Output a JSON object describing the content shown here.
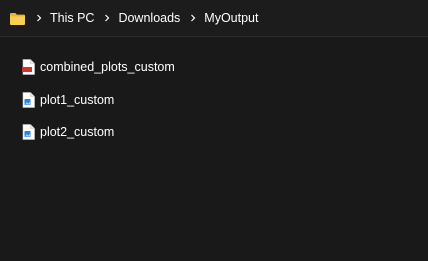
{
  "breadcrumb": {
    "items": [
      "This PC",
      "Downloads",
      "MyOutput"
    ]
  },
  "files": [
    {
      "name": "combined_plots_custom",
      "icon": "pdf-file-icon"
    },
    {
      "name": "plot1_custom",
      "icon": "image-file-icon"
    },
    {
      "name": "plot2_custom",
      "icon": "image-file-icon"
    }
  ],
  "colors": {
    "background": "#191919",
    "folder": "#f2c343",
    "pdf_badge": "#d9302c",
    "image_badge": "#2f7fd9"
  }
}
